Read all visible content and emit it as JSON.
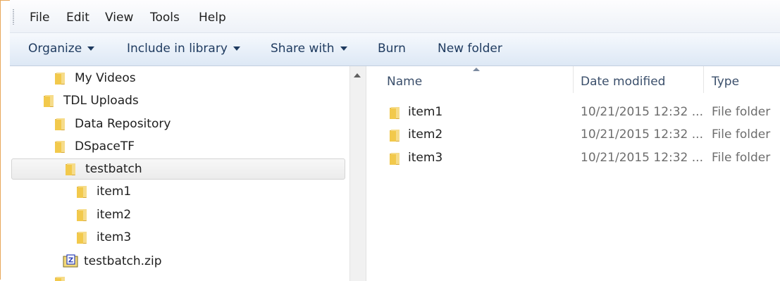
{
  "menu": {
    "items": [
      "File",
      "Edit",
      "View",
      "Tools",
      "Help"
    ]
  },
  "toolbar": {
    "organize": "Organize",
    "include_in_library": "Include in library",
    "share_with": "Share with",
    "burn": "Burn",
    "new_folder": "New folder"
  },
  "nav": {
    "items": [
      {
        "label": "My Videos",
        "icon": "folder-icon"
      },
      {
        "label": "TDL Uploads",
        "icon": "folder-icon"
      },
      {
        "label": "Data Repository",
        "icon": "folder-icon"
      },
      {
        "label": "DSpaceTF",
        "icon": "folder-icon"
      },
      {
        "label": "testbatch",
        "icon": "folder-icon",
        "selected": true
      },
      {
        "label": "item1",
        "icon": "folder-icon"
      },
      {
        "label": "item2",
        "icon": "folder-icon"
      },
      {
        "label": "item3",
        "icon": "folder-icon"
      },
      {
        "label": "testbatch.zip",
        "icon": "zip-archive-icon"
      }
    ]
  },
  "columns": {
    "name": "Name",
    "date_modified": "Date modified",
    "type": "Type"
  },
  "files": [
    {
      "name": "item1",
      "date_modified": "10/21/2015 12:32 ...",
      "type": "File folder"
    },
    {
      "name": "item2",
      "date_modified": "10/21/2015 12:32 ...",
      "type": "File folder"
    },
    {
      "name": "item3",
      "date_modified": "10/21/2015 12:32 ...",
      "type": "File folder"
    }
  ],
  "colors": {
    "folder_yellow": "#f2c94c",
    "selection_grey": "#ececec",
    "toolbar_blue": "#dde8f5",
    "frame_orange": "#e8a85a"
  }
}
